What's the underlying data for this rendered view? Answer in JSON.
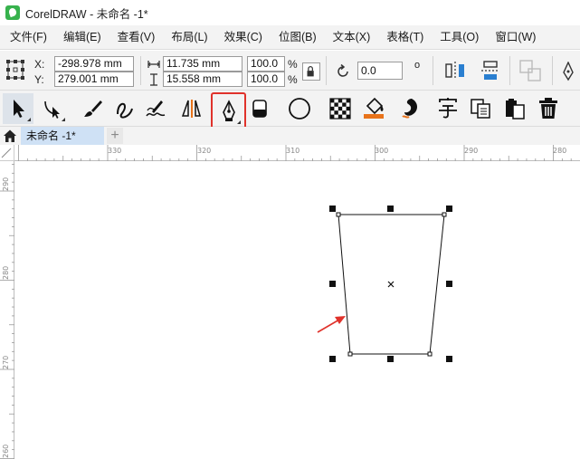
{
  "window": {
    "title": "CorelDRAW - 未命名 -1*"
  },
  "menu": [
    "文件(F)",
    "编辑(E)",
    "查看(V)",
    "布局(L)",
    "效果(C)",
    "位图(B)",
    "文本(X)",
    "表格(T)",
    "工具(O)",
    "窗口(W)"
  ],
  "property_bar": {
    "x_label": "X:",
    "y_label": "Y:",
    "x_value": "-298.978 mm",
    "y_value": "279.001 mm",
    "width_value": "11.735 mm",
    "height_value": "15.558 mm",
    "scale_x": "100.0",
    "scale_y": "100.0",
    "percent_x": "%",
    "percent_y": "%",
    "rotation_value": "0.0",
    "degree_symbol": "o"
  },
  "toolbox": [
    {
      "name": "pick-tool",
      "selected": true
    },
    {
      "name": "shape-tool"
    },
    {
      "name": "artistic-media-tool"
    },
    {
      "name": "freehand-tool"
    },
    {
      "name": "smart-drawing-tool"
    },
    {
      "name": "dimension-tool"
    },
    {
      "name": "pen-tool",
      "highlighted": true
    },
    {
      "name": "eraser-tool"
    },
    {
      "name": "ellipse-tool"
    },
    {
      "name": "pattern-fill-tool"
    },
    {
      "name": "interactive-fill-tool"
    },
    {
      "name": "smear-tool"
    },
    {
      "name": "text-tool"
    },
    {
      "name": "copy-properties-tool"
    },
    {
      "name": "paste-tool"
    },
    {
      "name": "delete-tool"
    }
  ],
  "document_tab": {
    "label": "未命名 -1*",
    "add_label": "+"
  },
  "rulers": {
    "horizontal_labels": [
      "330",
      "320",
      "310",
      "300",
      "290",
      "280"
    ],
    "vertical_labels": [
      "290",
      "280",
      "270",
      "260"
    ]
  },
  "colors": {
    "accent_highlight": "#e0322b",
    "selected_tab": "#cfe1f5",
    "arrow": "#e0322b",
    "toolbar_bg": "#f3f3f3"
  }
}
